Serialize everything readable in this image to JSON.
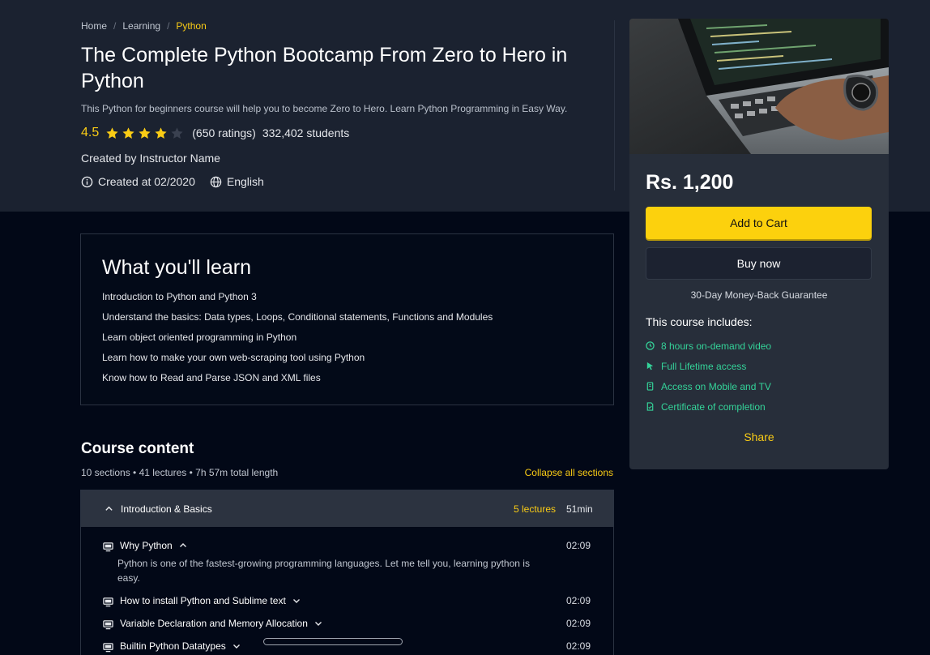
{
  "breadcrumb": {
    "items": [
      "Home",
      "Learning"
    ],
    "current": "Python",
    "separator": "/"
  },
  "course": {
    "title": "The Complete Python Bootcamp From Zero to Hero in Python",
    "subtitle": "This Python for beginners course will help you to become Zero to Hero. Learn Python Programming in Easy Way.",
    "rating": "4.5",
    "rating_value": 4.5,
    "rating_max": 5,
    "ratings_count": "(650 ratings)",
    "students": "332,402 students",
    "created_by": "Created by Instructor Name",
    "created_at": "Created at 02/2020",
    "language": "English"
  },
  "card": {
    "price": "Rs. 1,200",
    "add_to_cart": "Add to Cart",
    "buy_now": "Buy now",
    "guarantee": "30-Day Money-Back Guarantee",
    "includes_title": "This course includes:",
    "includes": [
      {
        "icon": "clock-icon",
        "label": "8 hours on-demand video"
      },
      {
        "icon": "cursor-icon",
        "label": "Full Lifetime access"
      },
      {
        "icon": "mobile-icon",
        "label": "Access on Mobile and TV"
      },
      {
        "icon": "certificate-icon",
        "label": "Certificate of completion"
      }
    ],
    "share": "Share"
  },
  "learn": {
    "title": "What you'll learn",
    "items": [
      "Introduction to Python and Python 3",
      "Understand the basics: Data types, Loops, Conditional statements, Functions and Modules",
      "Learn object oriented programming in Python",
      "Learn how to make your own web-scraping tool using Python",
      "Know how to Read and Parse JSON and XML files"
    ]
  },
  "content": {
    "title": "Course content",
    "summary": "10 sections • 41 lectures • 7h 57m total length",
    "collapse_label": "Collapse all sections",
    "section": {
      "name": "Introduction & Basics",
      "lectures": "5 lectures",
      "duration": "51min",
      "items": [
        {
          "name": "Why Python",
          "time": "02:09",
          "description": "Python is one of the fastest-growing programming languages. Let me tell you, learning python is easy.",
          "expanded": true
        },
        {
          "name": "How to install Python and Sublime text",
          "time": "02:09"
        },
        {
          "name": "Variable Declaration and Memory Allocation",
          "time": "02:09"
        },
        {
          "name": "Builtin Python Datatypes",
          "time": "02:09"
        }
      ]
    }
  },
  "colors": {
    "accent": "#facc15",
    "success": "#34d399",
    "hero_bg": "#1b2230",
    "page_bg": "#020817",
    "card_bg": "#272e3a"
  }
}
